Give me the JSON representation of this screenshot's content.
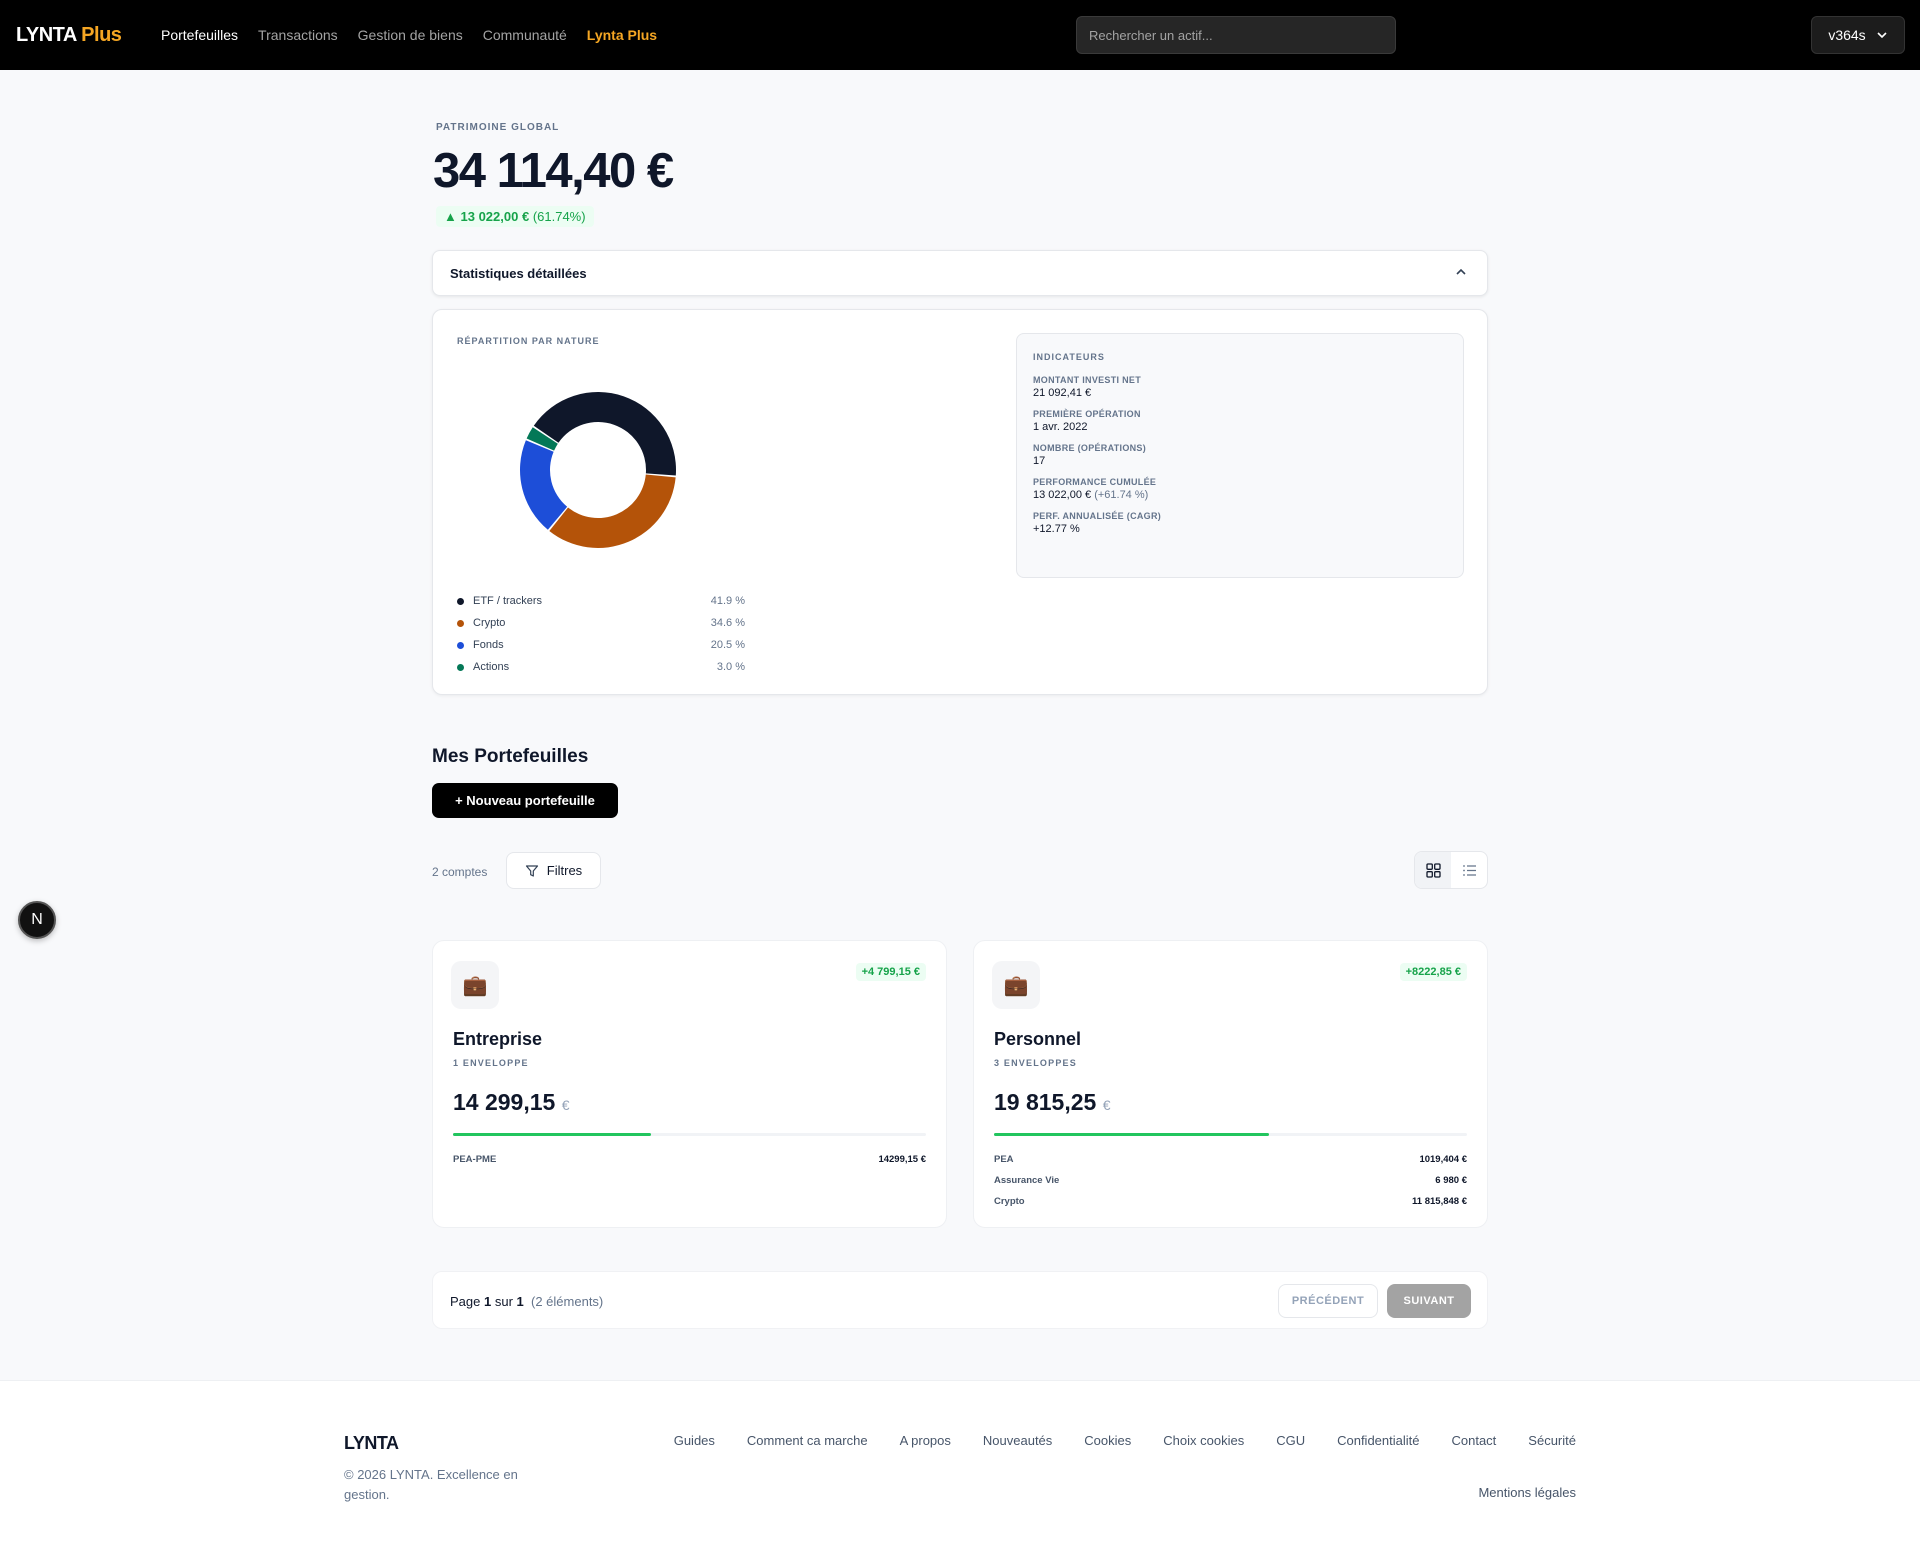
{
  "nav": {
    "logo_main": "LYNTA",
    "logo_plus": "Plus",
    "links": [
      "Portefeuilles",
      "Transactions",
      "Gestion de biens",
      "Communauté",
      "Lynta Plus"
    ],
    "search_placeholder": "Rechercher un actif...",
    "user": "v364s"
  },
  "header": {
    "kicker": "PATRIMOINE GLOBAL",
    "total": "34 114,40 €",
    "delta_amount": "13 022,00 €",
    "delta_pct": "(61.74%)"
  },
  "stats": {
    "title": "Statistiques détaillées",
    "repartition_label": "RÉPARTITION PAR NATURE",
    "indicators_title": "INDICATEURS",
    "indicators": [
      {
        "label": "MONTANT INVESTI NET",
        "value": "21 092,41 €",
        "extra": ""
      },
      {
        "label": "PREMIÈRE OPÉRATION",
        "value": "1 avr. 2022",
        "extra": ""
      },
      {
        "label": "NOMBRE (OPÉRATIONS)",
        "value": "17",
        "extra": ""
      },
      {
        "label": "PERFORMANCE CUMULÉE",
        "value": "13 022,00 €",
        "extra": "(+61.74 %)"
      },
      {
        "label": "PERF. ANNUALISÉE (CAGR)",
        "value": "+12.77 %",
        "extra": ""
      }
    ]
  },
  "chart_data": {
    "type": "pie",
    "categories": [
      "ETF / trackers",
      "Crypto",
      "Fonds",
      "Actions"
    ],
    "values": [
      41.9,
      34.6,
      20.5,
      3.0
    ],
    "labels": [
      "41.9 %",
      "34.6 %",
      "20.5 %",
      "3.0 %"
    ],
    "colors": [
      "#0f172a",
      "#b45309",
      "#1d4ed8",
      "#047857"
    ],
    "title": ""
  },
  "portfolios": {
    "heading": "Mes Portefeuilles",
    "new_button": "+ Nouveau portefeuille",
    "count": "2 comptes",
    "filter_label": "Filtres",
    "cards": [
      {
        "name": "Entreprise",
        "envelopes": "1 ENVELOPPE",
        "value": "14 299,15",
        "currency": "€",
        "gain": "+4 799,15 €",
        "share": 0.419,
        "rows": [
          {
            "k": "PEA-PME",
            "v": "14299,15 €"
          }
        ]
      },
      {
        "name": "Personnel",
        "envelopes": "3 ENVELOPPES",
        "value": "19 815,25",
        "currency": "€",
        "gain": "+8222,85 €",
        "share": 0.581,
        "rows": [
          {
            "k": "PEA",
            "v": "1019,404 €"
          },
          {
            "k": "Assurance Vie",
            "v": "6 980 €"
          },
          {
            "k": "Crypto",
            "v": "11 815,848 €"
          }
        ]
      }
    ]
  },
  "pagination": {
    "page_word": "Page",
    "current": "1",
    "of_word": "sur",
    "total": "1",
    "items": "(2 éléments)",
    "prev": "PRÉCÉDENT",
    "next": "SUIVANT"
  },
  "fab": "N",
  "footer": {
    "brand": "LYNTA",
    "copy": "© 2026 LYNTA. Excellence en gestion.",
    "links": [
      "Guides",
      "Comment ca marche",
      "A propos",
      "Nouveautés",
      "Cookies",
      "Choix cookies",
      "CGU",
      "Confidentialité",
      "Contact",
      "Sécurité"
    ],
    "legal": "Mentions légales"
  }
}
